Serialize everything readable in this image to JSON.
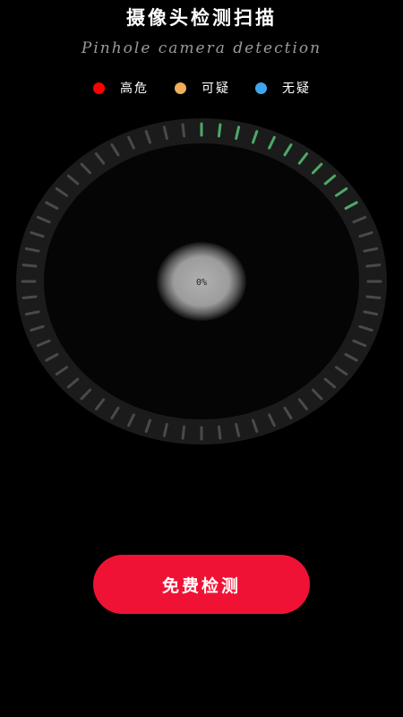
{
  "header": {
    "title": "摄像头检测扫描",
    "subtitle": "Pinhole camera detection"
  },
  "legend": [
    {
      "label": "高危",
      "color": "#ff0000"
    },
    {
      "label": "可疑",
      "color": "#f0ad5a"
    },
    {
      "label": "无疑",
      "color": "#3fa6ee"
    }
  ],
  "scanner": {
    "progress_text": "0%",
    "progress": 0,
    "active_tick_color": "#4ea86a",
    "inactive_tick_color": "#4a4a4a",
    "tick_count": 60,
    "active_ticks": 11
  },
  "action": {
    "button_label": "免费检测",
    "button_color": "#f01234"
  }
}
